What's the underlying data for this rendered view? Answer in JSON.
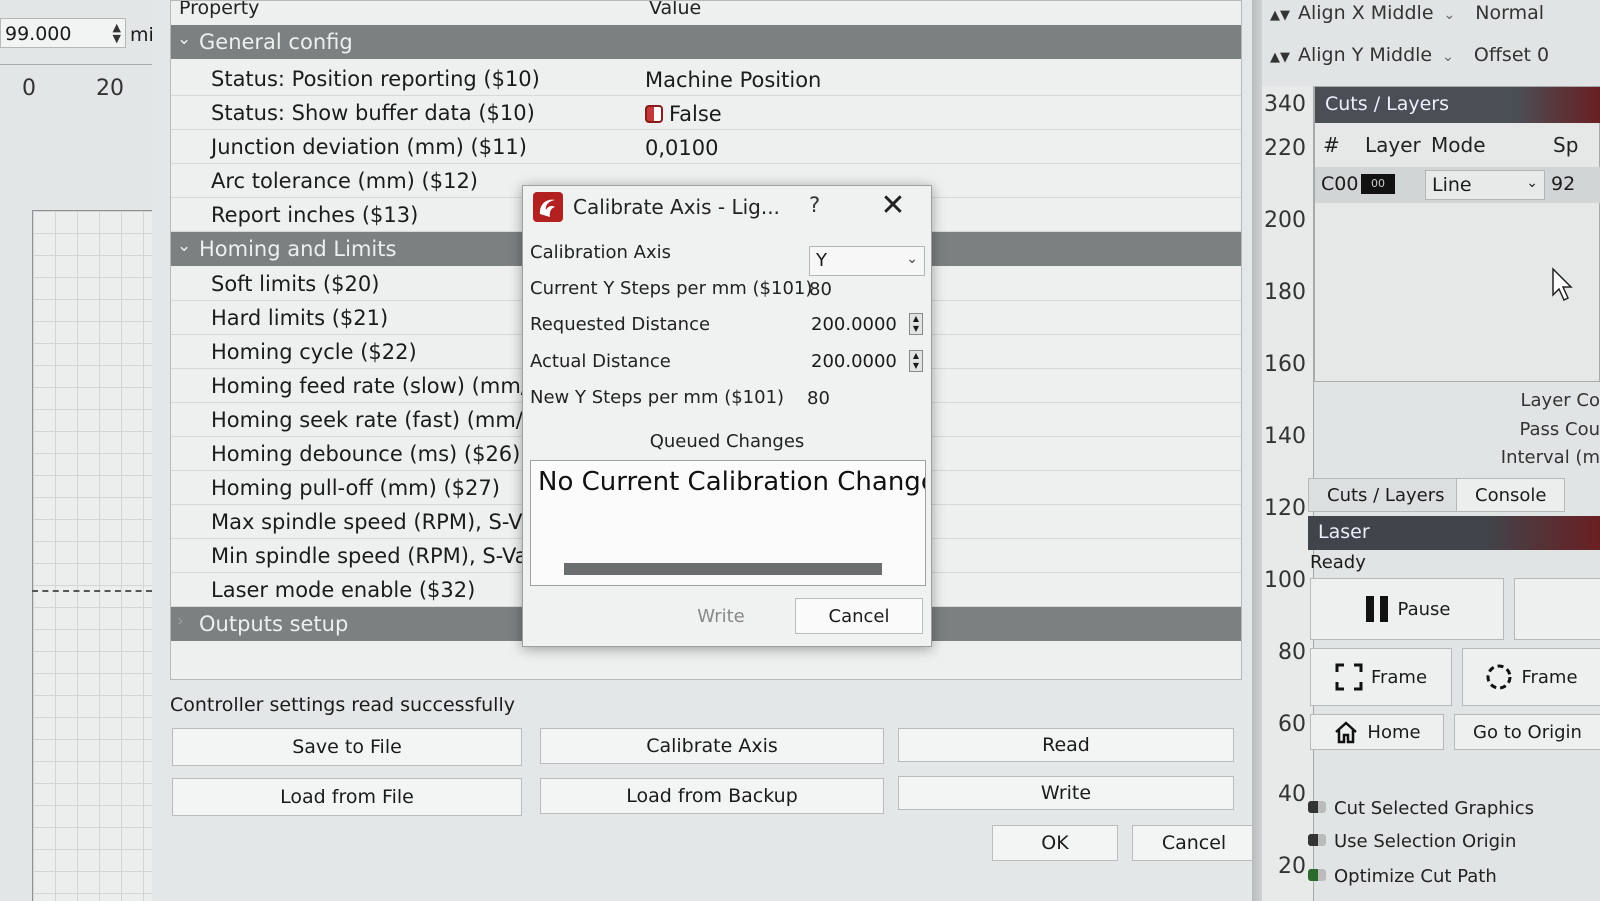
{
  "left": {
    "spin_value": "99.000",
    "unit": "mi",
    "ruler_ticks": [
      "0",
      "20"
    ]
  },
  "settings": {
    "col_property": "Property",
    "col_value": "Value",
    "groups": [
      {
        "label": "General config",
        "expanded": true
      },
      {
        "label": "Homing and Limits",
        "expanded": true
      },
      {
        "label": "Outputs setup",
        "expanded": false
      }
    ],
    "rows": [
      {
        "name": "Status: Position reporting ($10)",
        "value": "Machine Position"
      },
      {
        "name": "Status: Show buffer data ($10)",
        "value": "False"
      },
      {
        "name": "Junction deviation (mm) ($11)",
        "value": "0,0100"
      },
      {
        "name": "Arc tolerance (mm) ($12)",
        "value": ""
      },
      {
        "name": "Report inches ($13)",
        "value": ""
      },
      {
        "name": "Soft limits ($20)",
        "value": ""
      },
      {
        "name": "Hard limits ($21)",
        "value": ""
      },
      {
        "name": "Homing cycle ($22)",
        "value": ""
      },
      {
        "name": "Homing feed rate (slow) (mm/m",
        "value": ""
      },
      {
        "name": "Homing seek rate (fast) (mm/mi",
        "value": ""
      },
      {
        "name": "Homing debounce (ms) ($26)",
        "value": ""
      },
      {
        "name": "Homing pull-off (mm) ($27)",
        "value": ""
      },
      {
        "name": "Max spindle speed (RPM), S-Valu",
        "value": ""
      },
      {
        "name": "Min spindle speed (RPM), S-Valu",
        "value": ""
      },
      {
        "name": "Laser mode enable ($32)",
        "value": ""
      }
    ],
    "status_message": "Controller settings read successfully",
    "buttons": {
      "save_to_file": "Save to File",
      "calibrate_axis": "Calibrate Axis",
      "read": "Read",
      "load_from_file": "Load from File",
      "load_from_backup": "Load from Backup",
      "write": "Write",
      "ok": "OK",
      "cancel": "Cancel"
    }
  },
  "right": {
    "align_x": "Align X Middle",
    "normal": "Normal",
    "align_y": "Align Y Middle",
    "offset": "Offset 0",
    "vruler_ticks": [
      "340",
      "220",
      "200",
      "180",
      "160",
      "140",
      "120",
      "100",
      "80",
      "60",
      "40",
      "20"
    ],
    "cuts_title": "Cuts / Layers",
    "cuts_headers": [
      "#",
      "Layer",
      "Mode",
      "Sp"
    ],
    "cuts_row": {
      "id": "C00",
      "swatch": "00",
      "mode": "Line",
      "speed": "92"
    },
    "layer_color_label": "Layer Co",
    "pass_count_label": "Pass Cou",
    "interval_label": "Interval (m",
    "tab_cuts": "Cuts / Layers",
    "tab_console": "Console",
    "laser_title": "Laser",
    "laser_status": "Ready",
    "pause": "Pause",
    "frame": "Frame",
    "frame2": "Frame",
    "home": "Home",
    "go_to_origin": "Go to Origin",
    "cut_selected": "Cut Selected Graphics",
    "use_selection_origin": "Use Selection Origin",
    "optimize_cut_path": "Optimize Cut Path",
    "accent_color": "#6a1f22"
  },
  "dialog": {
    "title": "Calibrate Axis - Lig...",
    "help": "?",
    "close": "✕",
    "axis_label": "Calibration Axis",
    "axis_value": "Y",
    "current_steps_label": "Current Y Steps per mm ($101)",
    "current_steps_value": "80",
    "requested_label": "Requested Distance",
    "requested_value": "200.0000",
    "actual_label": "Actual Distance",
    "actual_value": "200.0000",
    "new_steps_label": "New Y Steps per mm ($101)",
    "new_steps_value": "80",
    "queued_label": "Queued Changes",
    "queue_text": "No Current Calibration Change",
    "write": "Write",
    "cancel": "Cancel"
  }
}
